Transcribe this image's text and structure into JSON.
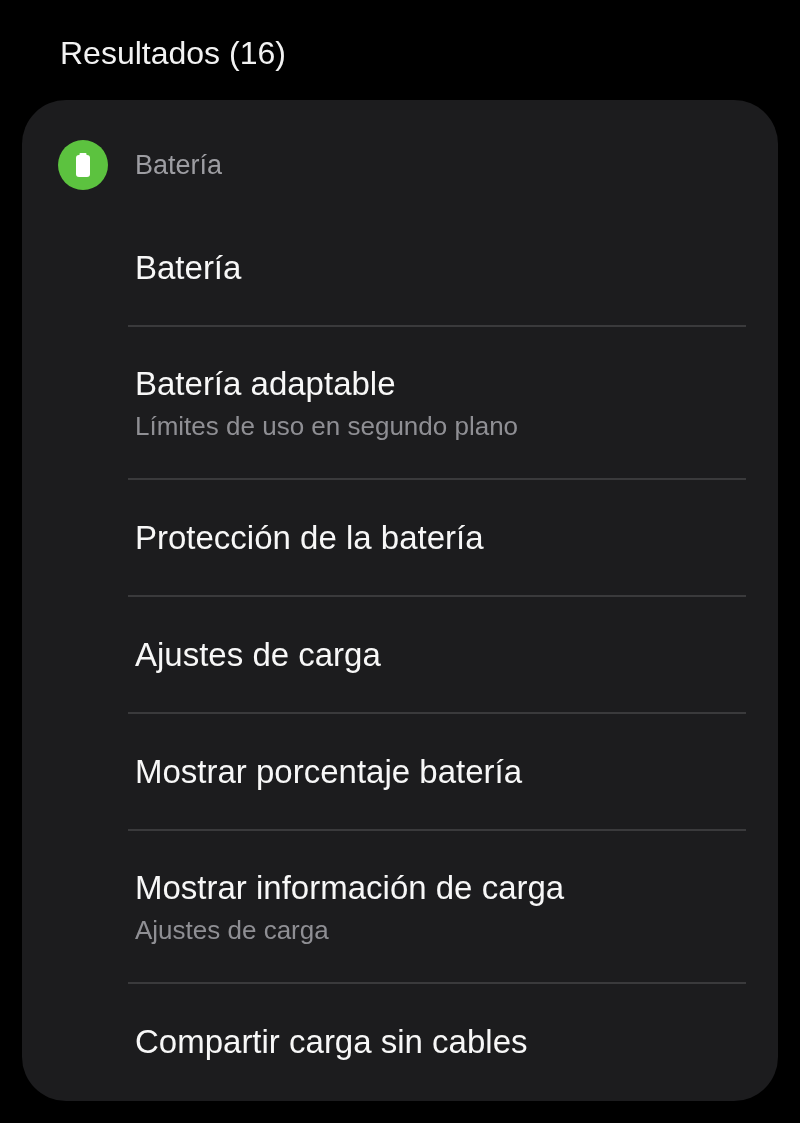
{
  "heading": "Resultados (16)",
  "groups": [
    {
      "category": "Batería",
      "items": [
        {
          "title": "Batería"
        },
        {
          "title": "Batería adaptable",
          "subtitle": "Límites de uso en segundo plano"
        },
        {
          "title": "Protección de la batería"
        },
        {
          "title": "Ajustes de carga"
        },
        {
          "title": "Mostrar porcentaje batería"
        },
        {
          "title": "Mostrar información de carga",
          "subtitle": "Ajustes de carga"
        },
        {
          "title": "Compartir carga sin cables"
        }
      ]
    }
  ]
}
